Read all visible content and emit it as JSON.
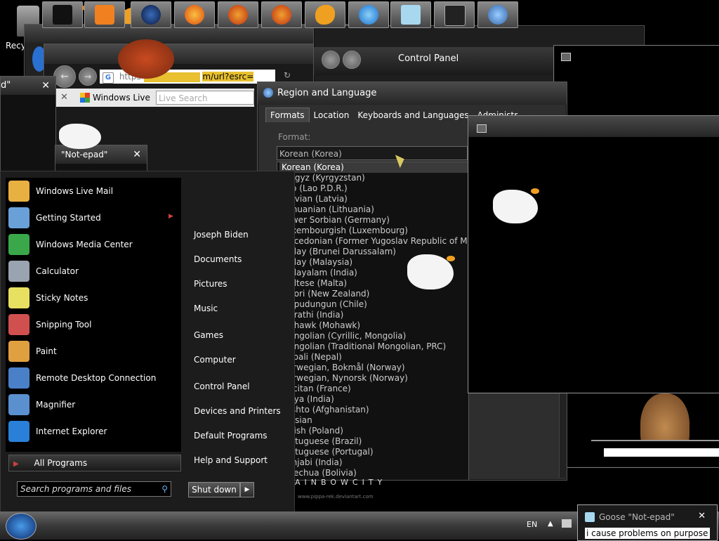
{
  "desktop": {
    "recycle_label": "Recy"
  },
  "browser": {
    "url_fragment": "m/url?esrc=",
    "tab_label": "Windows Live",
    "search_placeholder": "Live Search",
    "url_prefix": "https"
  },
  "left_windows": {
    "w1_title": "d\"",
    "w2_title": "\"Not-epad\""
  },
  "control_panel": {
    "title": "Control Panel"
  },
  "region_dialog": {
    "title": "Region and Language",
    "tabs": [
      "Formats",
      "Location",
      "Keyboards and Languages",
      "Administr"
    ],
    "format_label": "Format:",
    "selected_value": "Korean (Korea)",
    "options": [
      "Korean (Korea)",
      "Kyrgyz (Kyrgyzstan)",
      "Lao (Lao P.D.R.)",
      "Latvian (Latvia)",
      "Lithuanian (Lithuania)",
      "Lower Sorbian (Germany)",
      "Luxembourgish (Luxembourg)",
      "Macedonian (Former Yugoslav Republic of Macedo",
      "Malay (Brunei Darussalam)",
      "Malay (Malaysia)",
      "Malayalam (India)",
      "Maltese (Malta)",
      "Maori (New Zealand)",
      "Mapudungun (Chile)",
      "Marathi (India)",
      "Mohawk (Mohawk)",
      "Mongolian (Cyrillic, Mongolia)",
      "Mongolian (Traditional Mongolian, PRC)",
      "Nepali (Nepal)",
      "Norwegian, Bokmål (Norway)",
      "Norwegian, Nynorsk (Norway)",
      "Occitan (France)",
      "Oriya (India)",
      "Pashto (Afghanistan)",
      "Persian",
      "Polish (Poland)",
      "Portuguese (Brazil)",
      "Portuguese (Portugal)",
      "Punjabi (India)",
      "Quechua (Bolivia)"
    ]
  },
  "start_menu": {
    "programs": [
      {
        "label": "Windows Live Mail",
        "color": "#e8b040"
      },
      {
        "label": "Getting Started",
        "color": "#6aa0d8"
      },
      {
        "label": "Windows Media Center",
        "color": "#3aa84a"
      },
      {
        "label": "Calculator",
        "color": "#9aa4b0"
      },
      {
        "label": "Sticky Notes",
        "color": "#e8e060"
      },
      {
        "label": "Snipping Tool",
        "color": "#d05050"
      },
      {
        "label": "Paint",
        "color": "#e0a040"
      },
      {
        "label": "Remote Desktop Connection",
        "color": "#4a80c8"
      },
      {
        "label": "Magnifier",
        "color": "#5a90d0"
      },
      {
        "label": "Internet Explorer",
        "color": "#2a80d8"
      }
    ],
    "all_programs": "All Programs",
    "right_items": [
      "Joseph Biden",
      "Documents",
      "Pictures",
      "Music",
      "Games",
      "Computer",
      "Control Panel",
      "Devices and Printers",
      "Default Programs",
      "Help and Support"
    ],
    "search_placeholder": "Search programs and files",
    "shutdown_label": "Shut down"
  },
  "banner": {
    "text": "AINBOWCITY",
    "subtext": "www.pippa-rek.deviantart.com"
  },
  "taskbar": {
    "language": "EN"
  },
  "notification": {
    "title": "Goose \"Not-epad\"",
    "body": "i cause problems on purpose"
  }
}
